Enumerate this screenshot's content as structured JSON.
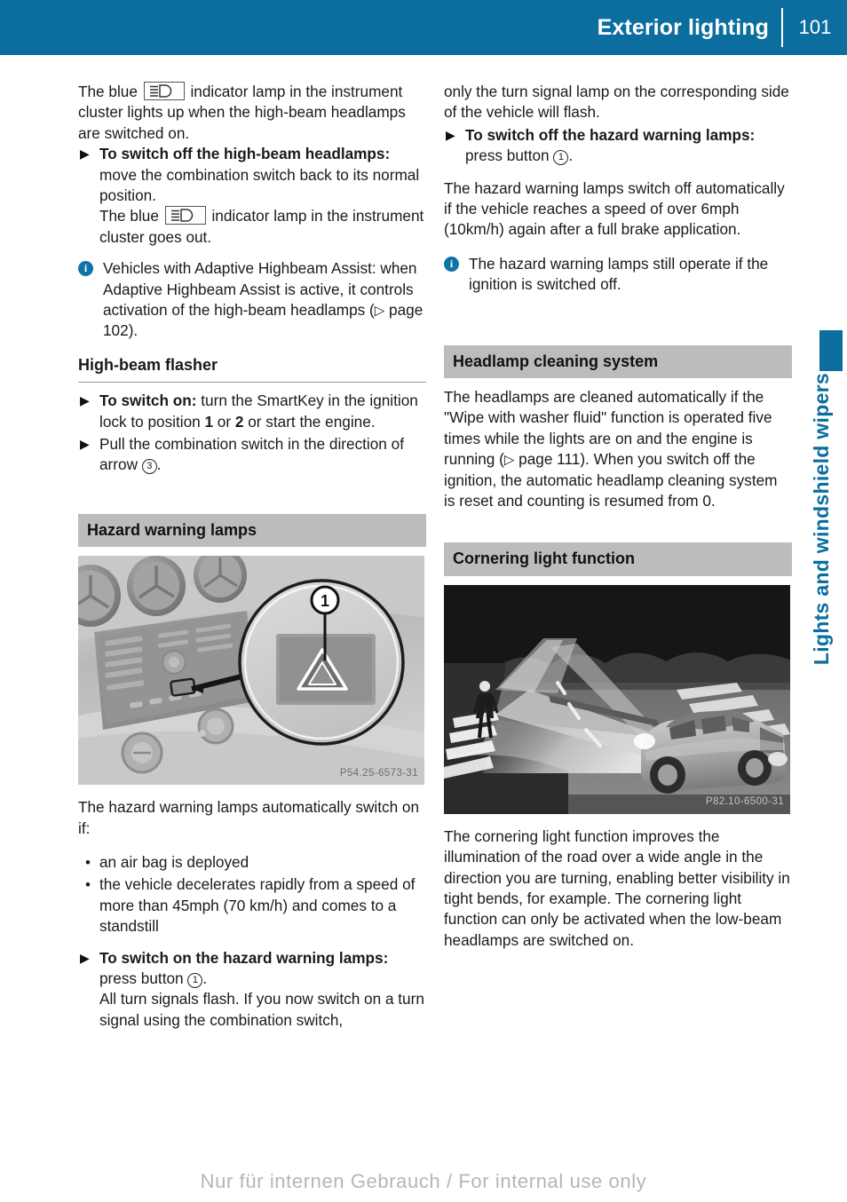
{
  "header": {
    "title": "Exterior lighting",
    "page_number": "101"
  },
  "side_tab": {
    "label": "Lights and windshield wipers",
    "color": "#0b6e9e"
  },
  "left_column": {
    "para_high_beam_on": {
      "before_icon": "The blue",
      "icon": "high-beam-indicator-icon",
      "after_icon": "indicator lamp in the instrument cluster lights up when the high-beam headlamps are switched on."
    },
    "step_switch_off": {
      "bold": "To switch off the high-beam headlamps:",
      "rest": " move the combination switch back to its normal position."
    },
    "para_goes_out": {
      "before_icon": "The blue",
      "icon": "high-beam-indicator-icon",
      "after_icon": "indicator lamp in the instrument cluster goes out."
    },
    "note_adaptive": {
      "text_a": "Vehicles with Adaptive Highbeam Assist: when Adaptive Highbeam Assist is active, it controls activation of the high-beam headlamps (",
      "page_ref": " page 102",
      "text_b": ")."
    },
    "subhead_flasher": "High-beam flasher",
    "step_switch_on": {
      "bold": "To switch on:",
      "rest_a": " turn the SmartKey in the ignition lock to position ",
      "pos_1": "1",
      "rest_b": " or ",
      "pos_2": "2",
      "rest_c": " or start the engine."
    },
    "step_pull": {
      "text_a": "Pull the combination switch in the direction of arrow ",
      "circled": "3",
      "text_b": "."
    },
    "section_hazard": "Hazard warning lamps",
    "figure_hazard": {
      "code": "P54.25-6573-31",
      "callout": "1",
      "alt": "center console with hazard warning lamp button magnified"
    },
    "para_auto_on": "The hazard warning lamps automatically switch on if:",
    "bullets": [
      "an air bag is deployed",
      "the vehicle decelerates rapidly from a speed of more than 45mph (70 km/h) and comes to a standstill"
    ],
    "step_hazard_on": {
      "bold": "To switch on the hazard warning lamps:",
      "rest_a": " press button ",
      "circled": "1",
      "rest_b": "."
    },
    "para_turn_signals": "All turn signals flash. If you now switch on a turn signal using the combination switch,"
  },
  "right_column": {
    "para_continue": "only the turn signal lamp on the corresponding side of the vehicle will flash.",
    "step_hazard_off": {
      "bold": "To switch off the hazard warning lamps:",
      "rest_a": " press button ",
      "circled": "1",
      "rest_b": "."
    },
    "para_auto_off": "The hazard warning lamps switch off automatically if the vehicle reaches a speed of over 6mph (10km/h) again after a full brake application.",
    "note_ignition": "The hazard warning lamps still operate if the ignition is switched off.",
    "section_headlamp_cleaning": "Headlamp cleaning system",
    "para_cleaning": {
      "text_a": "The headlamps are cleaned automatically if the \"Wipe with washer fluid\" function is operated five times while the lights are on and the engine is running (",
      "page_ref": " page 111",
      "text_b": "). When you switch off the ignition, the automatic headlamp cleaning system is reset and counting is resumed from 0."
    },
    "section_cornering": "Cornering light function",
    "figure_cornering": {
      "code": "P82.10-6500-31",
      "alt": "night intersection scene with car and pedestrian crosswalk lit by cornering light"
    },
    "para_cornering": "The cornering light function improves the illumination of the road over a wide angle in the direction you are turning, enabling better visibility in tight bends, for example. The cornering light function can only be activated when the low-beam headlamps are switched on."
  },
  "footer": {
    "text": "Nur für internen Gebrauch / For internal use only"
  },
  "icons": {
    "step_arrow": "▶",
    "bullet_dot": "•",
    "page_ref_triangle": "▷",
    "info": "i"
  }
}
